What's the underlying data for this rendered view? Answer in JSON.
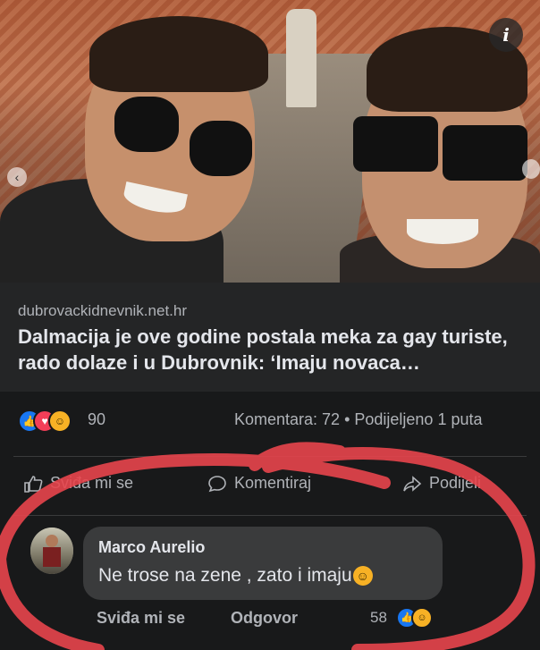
{
  "post": {
    "link_domain": "dubrovackidnevnik.net.hr",
    "link_title": "Dalmacija je ove godine postala meka za gay turiste, rado dolaze i u Dubrovnik: ‘Imaju novaca…",
    "info_icon": "i"
  },
  "stats": {
    "reaction_icons": [
      "like-icon",
      "love-icon",
      "haha-icon"
    ],
    "reaction_count": "90",
    "comments_shares": "Komentara: 72 • Podijeljeno 1 puta"
  },
  "actions": {
    "like_label": "Sviđa mi se",
    "comment_label": "Komentiraj",
    "share_label": "Podijeli"
  },
  "comment": {
    "author": "Marco Aurelio",
    "text": "Ne trose na zene , zato i imaju",
    "emoji": "smiling-face-emoji",
    "like_link": "Sviđa mi se",
    "reply_link": "Odgovor",
    "reaction_count": "58",
    "reaction_icons": [
      "like-icon",
      "haha-icon"
    ]
  },
  "colors": {
    "background": "#18191a",
    "card": "#242526",
    "bubble": "#3a3b3c",
    "like_blue": "#1877f2",
    "love_red": "#f33e58",
    "haha_yellow": "#f7b125",
    "annotation_red": "#e8454c"
  }
}
